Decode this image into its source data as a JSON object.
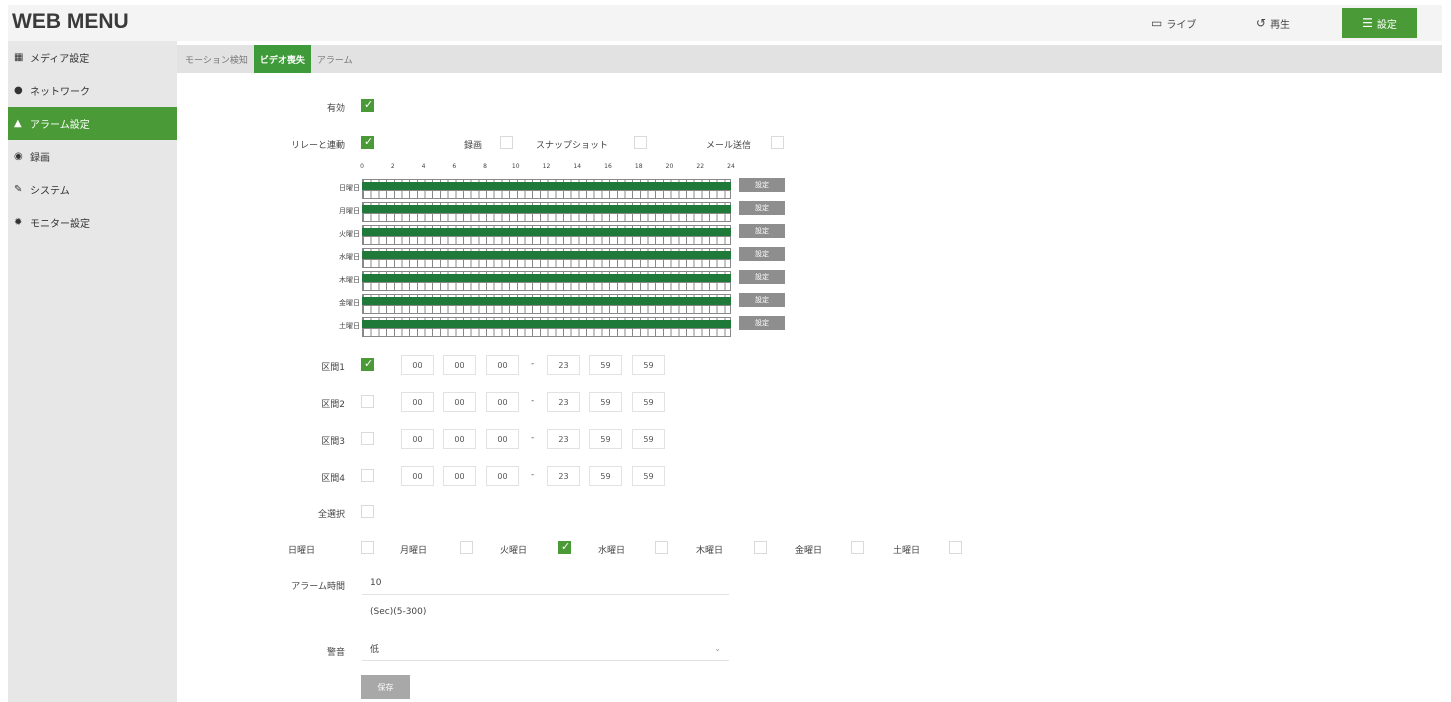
{
  "header": {
    "logo": "WEB MENU",
    "nav": [
      {
        "label": "ライブ",
        "icon": "monitor-icon"
      },
      {
        "label": "再生",
        "icon": "replay-icon"
      },
      {
        "label": "設定",
        "icon": "list-icon"
      }
    ]
  },
  "sidebar": {
    "items": [
      {
        "label": "メディア設定",
        "icon": "media-icon",
        "glyph": "▦"
      },
      {
        "label": "ネットワーク",
        "icon": "network-icon",
        "glyph": "●"
      },
      {
        "label": "アラーム設定",
        "icon": "alarm-icon",
        "glyph": "▲"
      },
      {
        "label": "録画",
        "icon": "record-icon",
        "glyph": "◉"
      },
      {
        "label": "システム",
        "icon": "wrench-icon",
        "glyph": "✎"
      },
      {
        "label": "モニター設定",
        "icon": "gear-icon",
        "glyph": "✹"
      }
    ],
    "active_index": 2
  },
  "tabs": [
    "モーション検知",
    "ビデオ喪失",
    "アラーム"
  ],
  "active_tab": 1,
  "form": {
    "enable_label": "有効",
    "enable": true,
    "relay_label": "リレーと連動",
    "relay": true,
    "record_label": "録画",
    "record": false,
    "snapshot_label": "スナップショット",
    "snapshot": false,
    "email_label": "メール送信",
    "email": false,
    "hour_ticks": [
      "0",
      "2",
      "4",
      "6",
      "8",
      "10",
      "12",
      "14",
      "16",
      "18",
      "20",
      "22",
      "24"
    ],
    "days": [
      "日曜日",
      "月曜日",
      "火曜日",
      "水曜日",
      "木曜日",
      "金曜日",
      "土曜日"
    ],
    "day_set_label": "設定",
    "periods": [
      {
        "label": "区間1",
        "checked": true,
        "start": [
          "00",
          "00",
          "00"
        ],
        "end": [
          "23",
          "59",
          "59"
        ]
      },
      {
        "label": "区間2",
        "checked": false,
        "start": [
          "00",
          "00",
          "00"
        ],
        "end": [
          "23",
          "59",
          "59"
        ]
      },
      {
        "label": "区間3",
        "checked": false,
        "start": [
          "00",
          "00",
          "00"
        ],
        "end": [
          "23",
          "59",
          "59"
        ]
      },
      {
        "label": "区間4",
        "checked": false,
        "start": [
          "00",
          "00",
          "00"
        ],
        "end": [
          "23",
          "59",
          "59"
        ]
      }
    ],
    "select_all_label": "全選択",
    "weekday_checks": [
      {
        "label": "日曜日",
        "checked": false
      },
      {
        "label": "月曜日",
        "checked": false
      },
      {
        "label": "火曜日",
        "checked": true
      },
      {
        "label": "水曜日",
        "checked": false
      },
      {
        "label": "木曜日",
        "checked": false
      },
      {
        "label": "金曜日",
        "checked": false
      },
      {
        "label": "土曜日",
        "checked": false
      }
    ],
    "alarm_duration_label": "アラーム時間",
    "alarm_duration_value": "10",
    "alarm_duration_hint": "(Sec)(5-300)",
    "buzzer_label": "警音",
    "buzzer_value": "低",
    "save_label": "保存"
  },
  "colors": {
    "accent": "#4a9a37",
    "schedule": "#1f7a3a",
    "button_gray": "#8e8e8e"
  }
}
